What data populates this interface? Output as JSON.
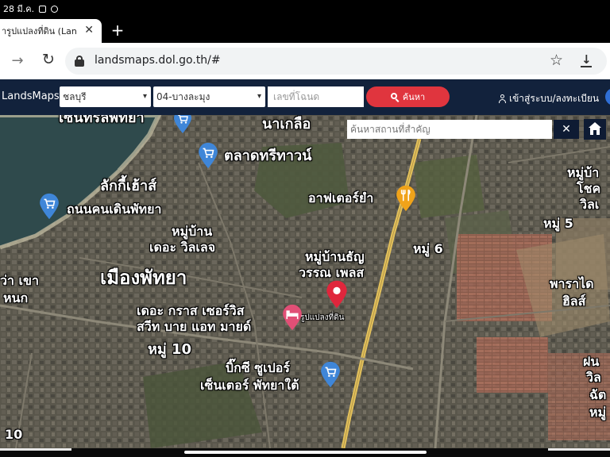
{
  "status_bar": {
    "time": "28 มี.ค."
  },
  "browser": {
    "tab_title": "ารูปแปลงที่ดิน (Lan",
    "tab_close": "✕",
    "new_tab": "+",
    "url": "landsmaps.dol.go.th/#",
    "back_glyph": "→",
    "reload_glyph": "↻",
    "star_glyph": "☆",
    "download_glyph": "↓"
  },
  "app": {
    "brand": "LandsMaps",
    "province": "ชลบุรี",
    "district": "04-บางละมุง",
    "caret": "▾",
    "parcel_placeholder": "เลขที่โฉนด",
    "search_label": "ค้นหา",
    "login_label": "เข้าสู่ระบบ/ลงทะเบียน"
  },
  "map": {
    "place_search_placeholder": "ค้นหาสถานที่สำคัญ",
    "clear_glyph": "✕",
    "labels": [
      "เซ็นทรัลพัทยา",
      "นาเกลือ",
      "ตลาดทรีทาวน์",
      "ลักกี้เฮ้าส์",
      "ถนนคนเดินพัทยา",
      "อาฟเตอร์ยำ",
      "หมู่บ้าน",
      "เดอะ วิลเลจ",
      "หมู่บ้านธัญ",
      "วรรณ เพลส",
      "หมู่ 6",
      "เมืองพัทยา",
      "เดอะ กราส เซอร์วิส",
      "สวีท บาย แอท มายด์",
      "รูปแปลงที่ดิน",
      "หมู่ 10",
      "บิ๊กซี ซูเปอร์",
      "เซ็นเตอร์ พัทยาใต้",
      "หมู่บ้า",
      "โชค",
      "วิลเ",
      "หมู่ 5",
      "พาราได",
      "ฮิลส์",
      "ฝน",
      "วิล",
      "ฉัต",
      "หมู่",
      "ว่า เขา",
      "หนก",
      "10"
    ]
  },
  "colors": {
    "header_bg": "#12223c",
    "search_button": "#e0353e",
    "pin_red": "#e0263c",
    "shop_pin_blue": "#3f86d8",
    "food_pin_orange": "#f0a31a",
    "hotel_pin_pink": "#e14f76",
    "road_yellow": "#e3c15b"
  },
  "icons": [
    "lock-icon",
    "star-icon",
    "download-icon",
    "search-icon",
    "user-icon",
    "close-icon",
    "home-icon",
    "location-pin-icon",
    "shopping-cart-icon",
    "restaurant-icon",
    "hotel-icon"
  ]
}
